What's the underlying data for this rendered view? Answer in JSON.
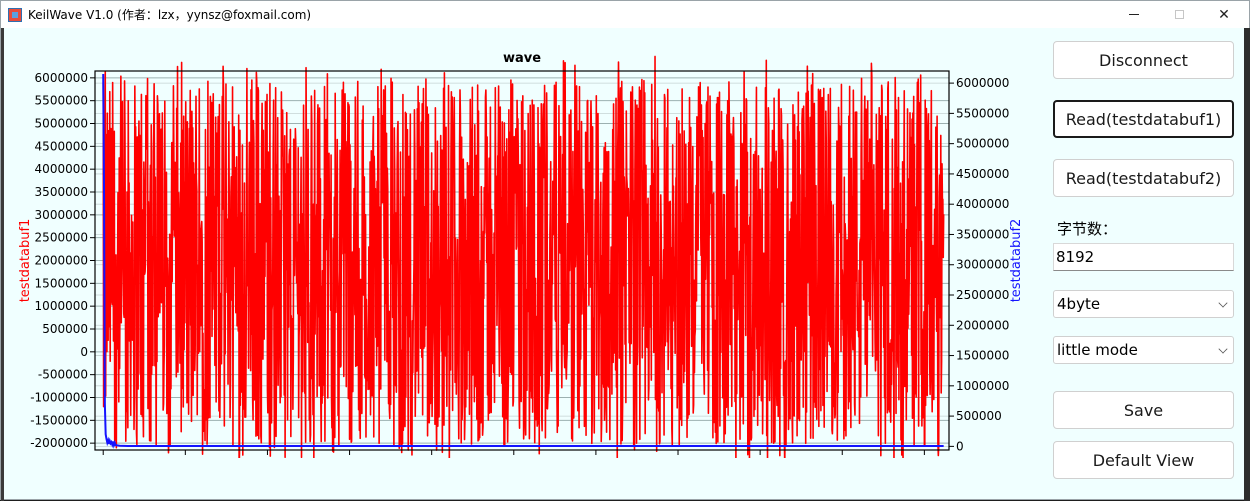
{
  "window": {
    "title": "KeilWave V1.0 (作者：lzx，yynsz@foxmail.com)",
    "controls": {
      "minimize_icon": "minimize-icon",
      "maximize_icon": "maximize-icon",
      "close_icon": "close-icon",
      "close_glyph": "✕"
    }
  },
  "buttons": {
    "disconnect": "Disconnect",
    "read1": "Read(testdatabuf1)",
    "read2": "Read(testdatabuf2)",
    "save": "Save",
    "default_view": "Default View"
  },
  "bytes": {
    "label": "字节数：",
    "value": "8192"
  },
  "width_select": {
    "selected": "4byte"
  },
  "endian_select": {
    "selected": "little mode"
  },
  "colors": {
    "series1": "#ff0000",
    "series2": "#1414ff",
    "grid": "#9cb0b0"
  },
  "chart_data": {
    "type": "line",
    "title": "wave",
    "xlim": [
      -20,
      2060
    ],
    "xticks": [
      "0",
      "200",
      "400",
      "600",
      "800",
      "1000",
      "1200",
      "1400",
      "1600",
      "1800",
      "2000"
    ],
    "left_axis": {
      "label": "testdatabuf1",
      "ylim": [
        -2150000,
        6150000
      ],
      "ticks": [
        "6000000",
        "5500000",
        "5000000",
        "4500000",
        "4000000",
        "3500000",
        "3000000",
        "2500000",
        "2000000",
        "1500000",
        "1000000",
        "500000",
        "0",
        "-500000",
        "-1000000",
        "-1500000",
        "-2000000"
      ]
    },
    "right_axis": {
      "label": "testdatabuf2",
      "ylim": [
        -60000,
        6200000
      ],
      "ticks": [
        "6000000",
        "5500000",
        "5000000",
        "4500000",
        "4000000",
        "3500000",
        "3000000",
        "2500000",
        "2000000",
        "1500000",
        "1000000",
        "500000",
        "0"
      ]
    },
    "series": [
      {
        "name": "testdatabuf1",
        "axis": "left",
        "n_points": 2048,
        "min": -2050000,
        "max": 5950000,
        "mean": 2000000,
        "start_values": [
          5900000,
          -1200000,
          4800000,
          2000000
        ]
      },
      {
        "name": "testdatabuf2",
        "axis": "right",
        "values_x": [
          0,
          2,
          4,
          6,
          8,
          10,
          12,
          14,
          16,
          18,
          20,
          22,
          24,
          26,
          28,
          30,
          40,
          60,
          100,
          500,
          1000,
          1500,
          2047
        ],
        "values_y": [
          6150000,
          4200000,
          700000,
          200000,
          120000,
          60000,
          100000,
          40000,
          90000,
          50000,
          70000,
          30000,
          80000,
          20000,
          60000,
          20000,
          10000,
          5000,
          5000,
          5000,
          5000,
          5000,
          5000
        ]
      }
    ]
  }
}
